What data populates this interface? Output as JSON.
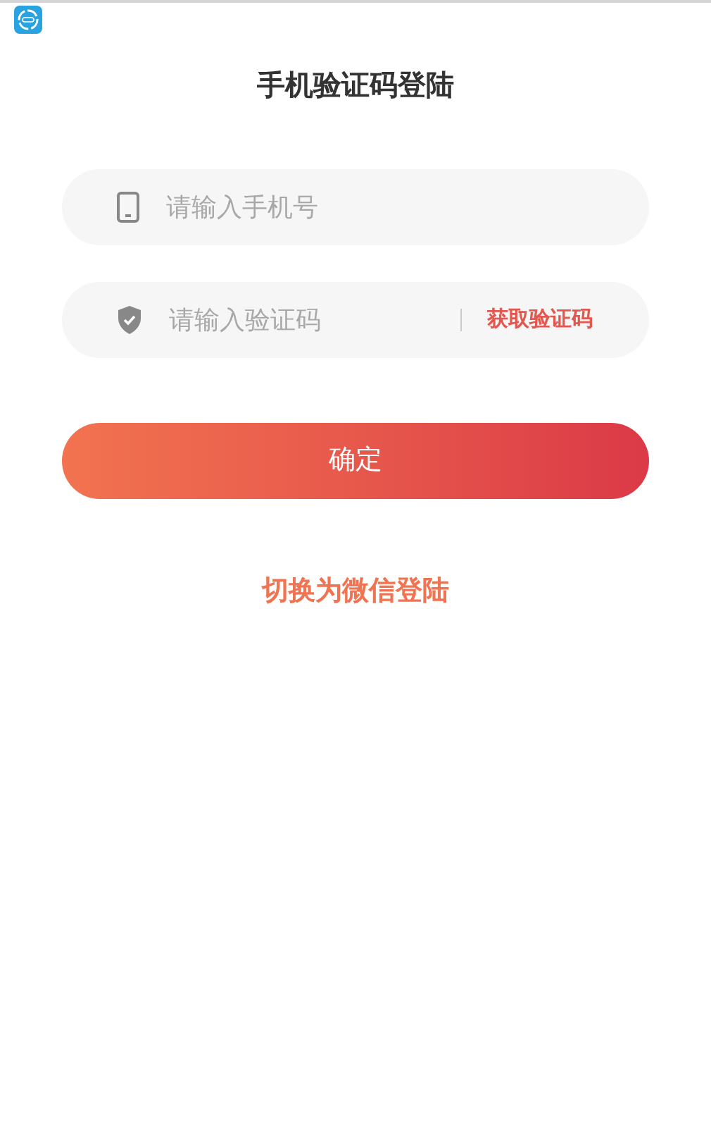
{
  "title": "手机验证码登陆",
  "phone_field": {
    "placeholder": "请输入手机号"
  },
  "code_field": {
    "placeholder": "请输入验证码"
  },
  "get_code_button": "获取验证码",
  "confirm_button": "确定",
  "switch_link": "切换为微信登陆"
}
